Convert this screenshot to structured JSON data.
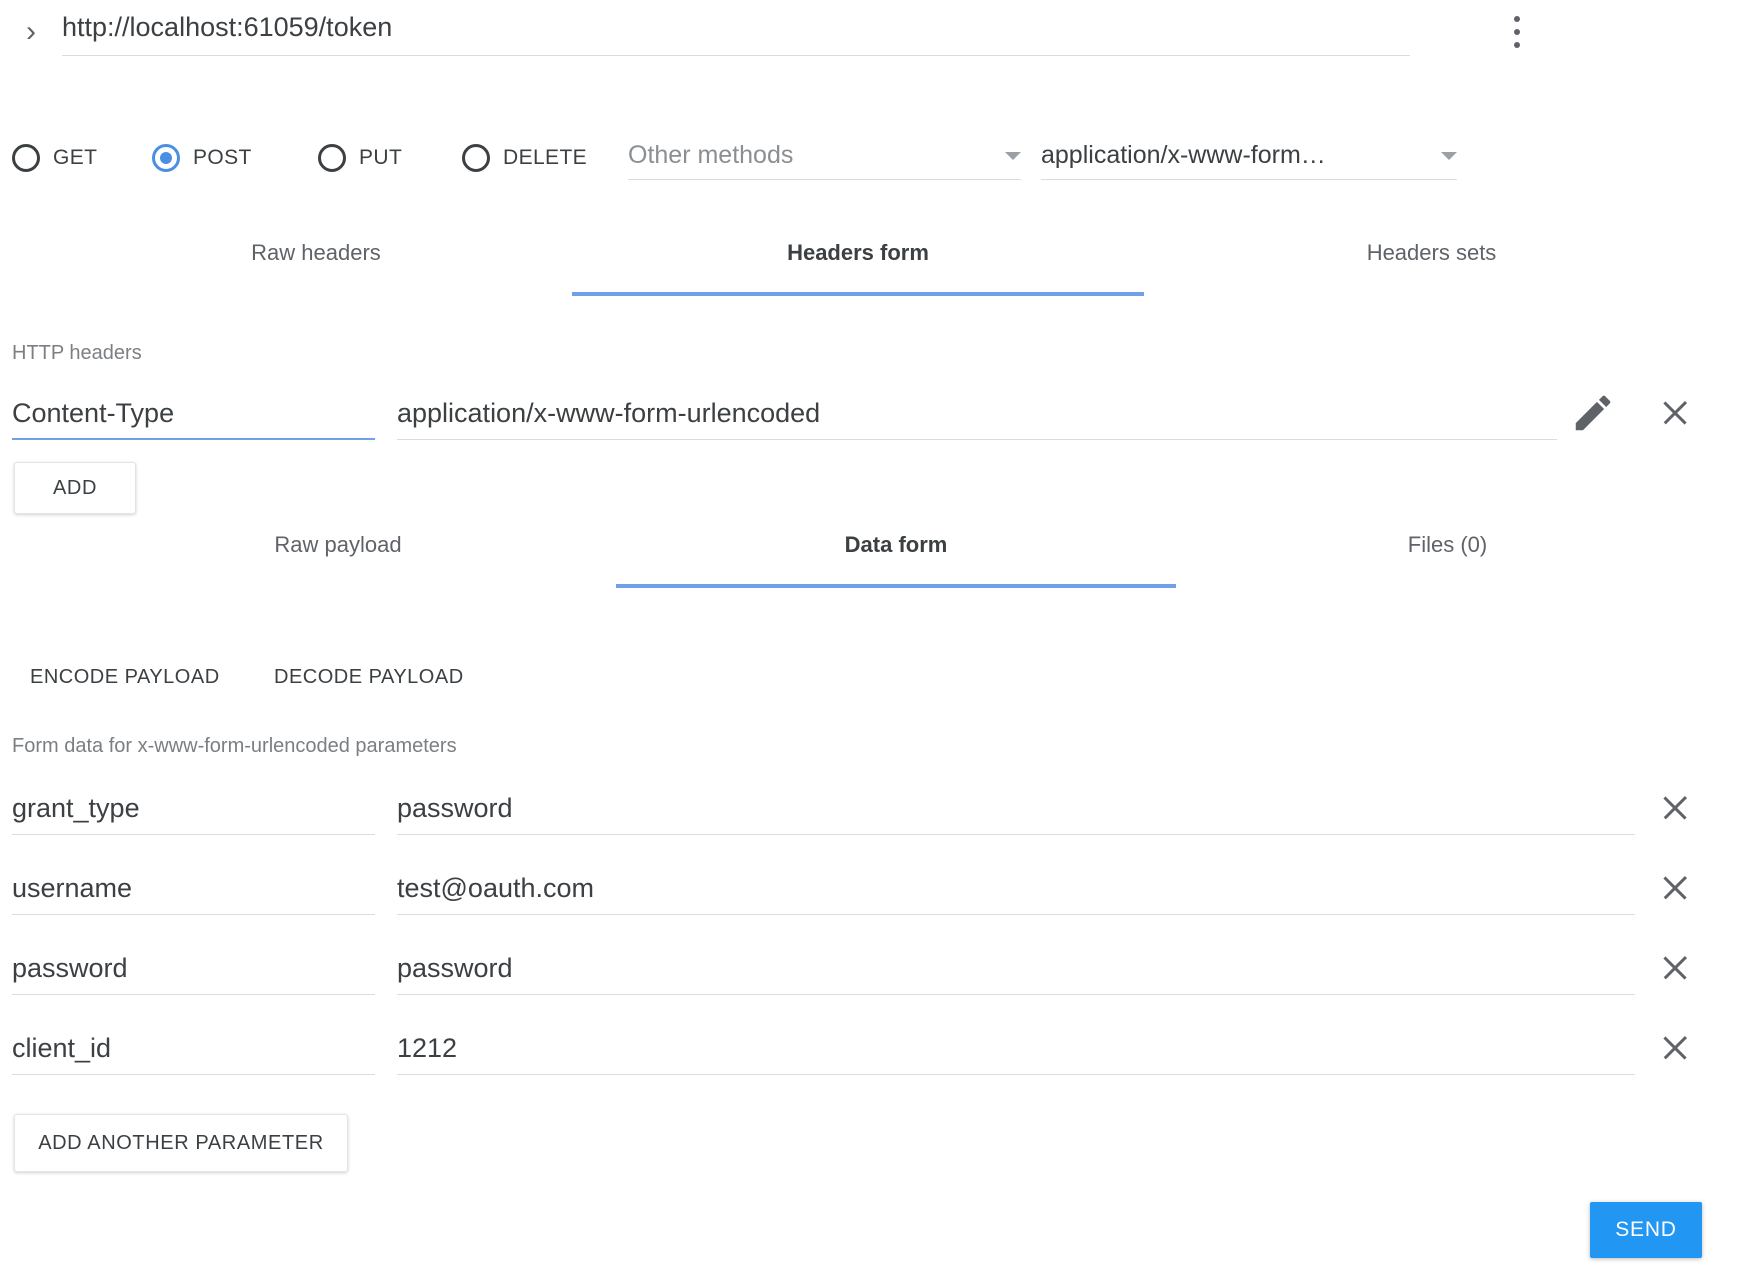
{
  "url_bar": {
    "chevron_icon": "chevron-right-icon",
    "url": "http://localhost:61059/token",
    "menu_icon": "more-vertical-icon"
  },
  "methods": {
    "options": [
      {
        "label": "GET",
        "selected": false
      },
      {
        "label": "POST",
        "selected": true
      },
      {
        "label": "PUT",
        "selected": false
      },
      {
        "label": "DELETE",
        "selected": false
      }
    ],
    "other_methods_placeholder": "Other methods",
    "content_type_value": "application/x-www-form…"
  },
  "header_tabs": [
    {
      "label": "Raw headers",
      "active": false
    },
    {
      "label": "Headers form",
      "active": true
    },
    {
      "label": "Headers sets",
      "active": false
    }
  ],
  "headers_section": {
    "label": "HTTP headers",
    "rows": [
      {
        "name": "Content-Type",
        "value": "application/x-www-form-urlencoded"
      }
    ],
    "edit_icon": "pencil-icon",
    "delete_icon": "close-icon",
    "add_label": "ADD"
  },
  "payload_tabs": [
    {
      "label": "Raw payload",
      "active": false
    },
    {
      "label": "Data form",
      "active": true
    },
    {
      "label": "Files (0)",
      "active": false
    }
  ],
  "payload_actions": {
    "encode_label": "ENCODE PAYLOAD",
    "decode_label": "DECODE PAYLOAD"
  },
  "data_form": {
    "label": "Form data for x-www-form-urlencoded parameters",
    "rows": [
      {
        "name": "grant_type",
        "value": "password"
      },
      {
        "name": "username",
        "value": "test@oauth.com"
      },
      {
        "name": "password",
        "value": "password"
      },
      {
        "name": "client_id",
        "value": "1212"
      }
    ],
    "delete_icon": "close-icon",
    "add_param_label": "ADD ANOTHER PARAMETER"
  },
  "footer": {
    "send_label": "SEND"
  },
  "colors": {
    "accent": "#6fa0e8",
    "send": "#2196f3",
    "radio_selected": "#4a90e2"
  }
}
